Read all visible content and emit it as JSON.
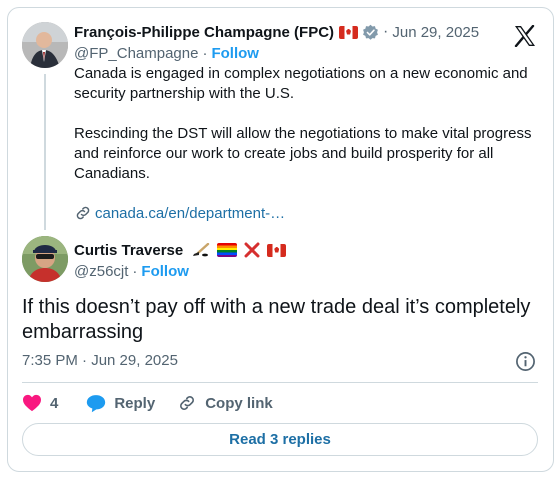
{
  "quoted_tweet": {
    "author_name": "François-Philippe Champagne (FPC)",
    "author_flag_icon": "canada-flag-icon",
    "verified_icon": "verified-badge-icon",
    "separator": "·",
    "date": "Jun 29, 2025",
    "handle": "@FP_Champagne",
    "follow_label": "Follow",
    "paragraphs": [
      "Canada is engaged in complex negotiations on a new economic and security partnership with the U.S.",
      "Rescinding the DST will allow the negotiations to make vital progress and reinforce our work to create jobs and build prosperity for all Canadians."
    ],
    "link_text": "canada.ca/en/department-…"
  },
  "reply_tweet": {
    "author_name": "Curtis Traverse",
    "emoji_icons": [
      "hockey-stick-icon",
      "rainbow-flag-icon",
      "red-x-icon",
      "canada-flag-icon"
    ],
    "handle": "@z56cjt",
    "follow_label": "Follow",
    "text": "If this doesn’t pay off with a new trade deal it’s completely embarrassing",
    "timestamp": "7:35 PM · Jun 29, 2025"
  },
  "actions": {
    "like_count": "4",
    "reply_label": "Reply",
    "copy_link_label": "Copy link"
  },
  "read_replies_label": "Read 3 replies",
  "colors": {
    "accent_blue": "#1d9bf0",
    "link_blue": "#1d6fa5",
    "like_pink": "#f91880",
    "secondary_text": "#536471",
    "border": "#cfd9de"
  }
}
